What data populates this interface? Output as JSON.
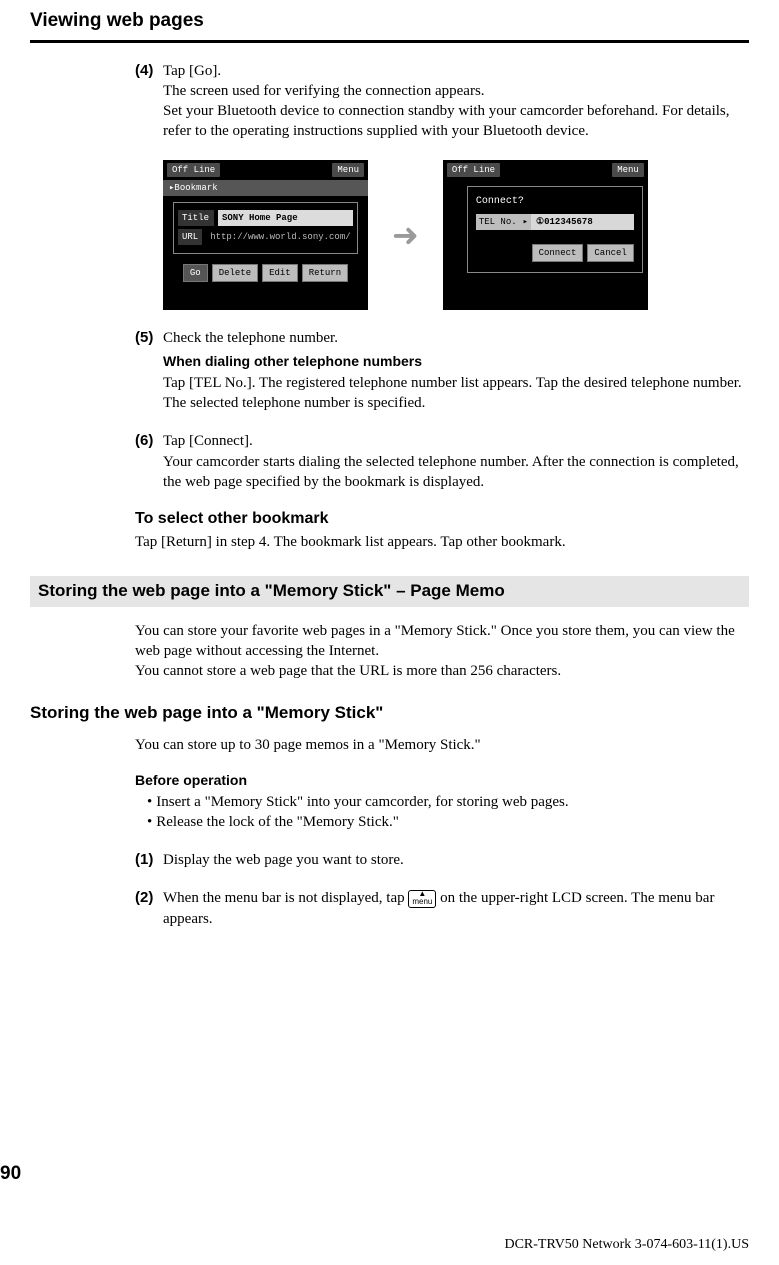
{
  "page": {
    "chapter_title": "Viewing web pages",
    "page_number": "90",
    "footer": "DCR-TRV50 Network 3-074-603-11(1).US"
  },
  "step4": {
    "num": "(4)",
    "line1": "Tap [Go].",
    "line2": "The screen used for verifying the connection appears.",
    "line3": "Set your Bluetooth device to connection standby with your camcorder beforehand. For details, refer to the operating instructions supplied with your Bluetooth device."
  },
  "lcd_left": {
    "status": "Off Line",
    "menu": "Menu",
    "bookmark_hdr": "▸Bookmark",
    "title_label": "Title",
    "title_value": "SONY Home Page",
    "url_label": "URL",
    "url_value": "http://www.world.sony.com/",
    "btn_go": "Go",
    "btn_delete": "Delete",
    "btn_edit": "Edit",
    "btn_return": "Return"
  },
  "lcd_right": {
    "status": "Off Line",
    "menu": "Menu",
    "connect_q": "Connect?",
    "tel_label": "TEL No.",
    "tel_arrow": "▸",
    "tel_value": "①012345678",
    "btn_connect": "Connect",
    "btn_cancel": "Cancel"
  },
  "arrow": "➜",
  "step5": {
    "num": "(5)",
    "line1": "Check the telephone number.",
    "subhead": "When dialing other telephone numbers",
    "line2": "Tap [TEL No.]. The registered telephone number list appears. Tap the desired telephone number. The selected telephone number is specified."
  },
  "step6": {
    "num": "(6)",
    "line1": "Tap [Connect].",
    "line2": "Your camcorder starts dialing the selected telephone number. After the connection is completed, the web page specified by the bookmark is displayed."
  },
  "select_other": {
    "heading": "To select other bookmark",
    "text": "Tap [Return] in step 4. The bookmark list appears. Tap other bookmark."
  },
  "section": {
    "bar": "Storing the web page into a \"Memory Stick\" – Page Memo",
    "intro": "You can store your favorite web pages in a \"Memory Stick.\" Once you store them, you can view the web page without accessing the Internet.",
    "intro2": "You cannot store a web page that the URL is more than 256 characters.",
    "subhead": "Storing the web page into a \"Memory Stick\"",
    "limit": "You can store up to 30 page memos in a \"Memory Stick.\"",
    "before_op": "Before operation",
    "bullet1": "Insert a \"Memory Stick\" into your camcorder, for storing web pages.",
    "bullet2": "Release the lock of the \"Memory Stick.\""
  },
  "step_b1": {
    "num": "(1)",
    "text": "Display the web page you want to store."
  },
  "step_b2": {
    "num": "(2)",
    "text_a": "When the menu bar is not displayed, tap ",
    "menu_chip_top": "▲",
    "menu_chip_text": "menu",
    "text_b": " on the upper-right LCD screen. The menu bar appears."
  }
}
